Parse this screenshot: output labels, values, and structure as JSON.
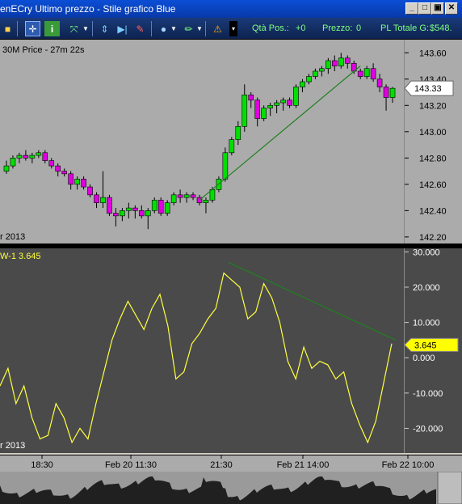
{
  "window": {
    "title": "enECry Ultimo prezzo - Stile grafico Blue"
  },
  "toolbar": {
    "qty_label": "Qtà Pos.:",
    "qty_value": "+0",
    "price_label": "Prezzo:",
    "price_value": "0",
    "pl_label": "PL Totale G:",
    "pl_value": "$548."
  },
  "price_panel": {
    "header": "30M Price - 27m 22s",
    "date_fragment": "r 2013",
    "current_price": "143.33",
    "y_ticks": [
      "143.60",
      "143.40",
      "143.20",
      "143.00",
      "142.80",
      "142.60",
      "142.40",
      "142.20"
    ]
  },
  "indicator_panel": {
    "header": "W-1  3.645",
    "date_fragment": "r 2013",
    "current_value": "3.645",
    "y_ticks": [
      "30.000",
      "20.000",
      "10.000",
      "0.000",
      "-10.000",
      "-20.000"
    ]
  },
  "time_axis": {
    "labels": [
      "18:30",
      "Feb 20 11:30",
      "21:30",
      "Feb 21 14:00",
      "Feb 22 10:00"
    ]
  },
  "colors": {
    "bull": "#00e000",
    "bear": "#e000e0",
    "indicator": "#ffff40",
    "trendline": "#208020",
    "badge": "#ffff00"
  },
  "chart_data": [
    {
      "type": "candlestick",
      "title": "30M Price - 27m 22s",
      "ylim": [
        142.15,
        143.7
      ],
      "ohlc": [
        [
          142.7,
          142.78,
          142.68,
          142.74
        ],
        [
          142.74,
          142.82,
          142.72,
          142.8
        ],
        [
          142.8,
          142.84,
          142.76,
          142.82
        ],
        [
          142.82,
          142.86,
          142.78,
          142.8
        ],
        [
          142.8,
          142.84,
          142.76,
          142.82
        ],
        [
          142.82,
          142.86,
          142.8,
          142.84
        ],
        [
          142.84,
          142.86,
          142.76,
          142.78
        ],
        [
          142.78,
          142.8,
          142.72,
          142.74
        ],
        [
          142.74,
          142.76,
          142.66,
          142.7
        ],
        [
          142.7,
          142.72,
          142.66,
          142.68
        ],
        [
          142.68,
          142.7,
          142.56,
          142.6
        ],
        [
          142.6,
          142.66,
          142.56,
          142.64
        ],
        [
          142.64,
          142.66,
          142.56,
          142.58
        ],
        [
          142.58,
          142.6,
          142.5,
          142.52
        ],
        [
          142.52,
          142.54,
          142.42,
          142.46
        ],
        [
          142.46,
          142.7,
          142.42,
          142.5
        ],
        [
          142.5,
          142.52,
          142.36,
          142.38
        ],
        [
          142.38,
          142.42,
          142.28,
          142.36
        ],
        [
          142.36,
          142.42,
          142.32,
          142.4
        ],
        [
          142.4,
          142.46,
          142.34,
          142.42
        ],
        [
          142.42,
          142.44,
          142.34,
          142.4
        ],
        [
          142.4,
          142.44,
          142.34,
          142.36
        ],
        [
          142.36,
          142.42,
          142.26,
          142.4
        ],
        [
          142.4,
          142.5,
          142.38,
          142.48
        ],
        [
          142.48,
          142.5,
          142.36,
          142.38
        ],
        [
          142.38,
          142.48,
          142.36,
          142.46
        ],
        [
          142.46,
          142.54,
          142.44,
          142.52
        ],
        [
          142.52,
          142.56,
          142.46,
          142.5
        ],
        [
          142.5,
          142.54,
          142.46,
          142.52
        ],
        [
          142.52,
          142.54,
          142.48,
          142.5
        ],
        [
          142.5,
          142.52,
          142.44,
          142.46
        ],
        [
          142.46,
          142.5,
          142.38,
          142.48
        ],
        [
          142.48,
          142.58,
          142.46,
          142.56
        ],
        [
          142.56,
          142.66,
          142.54,
          142.64
        ],
        [
          142.64,
          142.88,
          142.62,
          142.84
        ],
        [
          142.84,
          142.96,
          142.82,
          142.94
        ],
        [
          142.94,
          143.08,
          142.9,
          143.04
        ],
        [
          143.04,
          143.36,
          143.0,
          143.28
        ],
        [
          143.28,
          143.3,
          143.18,
          143.24
        ],
        [
          143.24,
          143.26,
          143.04,
          143.1
        ],
        [
          143.1,
          143.2,
          143.08,
          143.18
        ],
        [
          143.18,
          143.22,
          143.12,
          143.2
        ],
        [
          143.2,
          143.24,
          143.14,
          143.22
        ],
        [
          143.22,
          143.26,
          143.16,
          143.24
        ],
        [
          143.24,
          143.26,
          143.18,
          143.2
        ],
        [
          143.2,
          143.36,
          143.18,
          143.34
        ],
        [
          143.34,
          143.4,
          143.3,
          143.38
        ],
        [
          143.38,
          143.44,
          143.36,
          143.42
        ],
        [
          143.42,
          143.48,
          143.4,
          143.46
        ],
        [
          143.46,
          143.5,
          143.42,
          143.48
        ],
        [
          143.48,
          143.56,
          143.44,
          143.54
        ],
        [
          143.54,
          143.58,
          143.46,
          143.5
        ],
        [
          143.5,
          143.6,
          143.48,
          143.56
        ],
        [
          143.56,
          143.58,
          143.48,
          143.52
        ],
        [
          143.52,
          143.54,
          143.44,
          143.46
        ],
        [
          143.46,
          143.48,
          143.4,
          143.42
        ],
        [
          143.42,
          143.5,
          143.4,
          143.48
        ],
        [
          143.48,
          143.52,
          143.38,
          143.4
        ],
        [
          143.4,
          143.44,
          143.3,
          143.34
        ],
        [
          143.34,
          143.36,
          143.16,
          143.26
        ],
        [
          143.26,
          143.34,
          143.22,
          143.33
        ]
      ]
    },
    {
      "type": "line",
      "series": [
        {
          "name": "W-1",
          "values": [
            -8,
            -3,
            -13,
            -8,
            -17,
            -23,
            -22,
            -13,
            -17,
            -24,
            -20,
            -23,
            -13,
            -4,
            5,
            11,
            16,
            12,
            8,
            14,
            18,
            9,
            -6,
            -4,
            4,
            7,
            11,
            14,
            24,
            22,
            20,
            11,
            13,
            21,
            17,
            10,
            -1,
            -6,
            3,
            -3,
            -1,
            -2,
            -6,
            -4,
            -13,
            -19,
            -24,
            -18,
            -7,
            4
          ]
        },
        {
          "name": "trendline",
          "values": [
            27,
            5
          ]
        }
      ],
      "ylim": [
        -27,
        31
      ]
    }
  ]
}
